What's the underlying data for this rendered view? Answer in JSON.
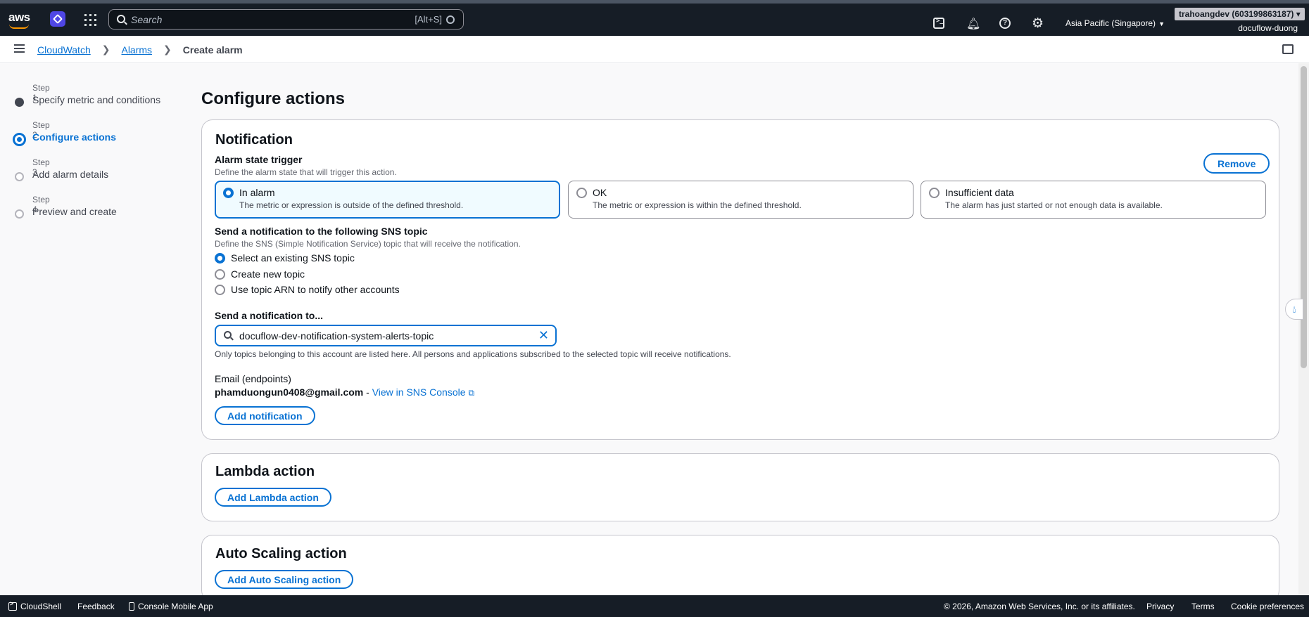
{
  "topnav": {
    "logo_text": "aws",
    "search_placeholder": "Search",
    "search_shortcut": "[Alt+S]",
    "region": "Asia Pacific (Singapore)",
    "account_badge": "trahoangdev (603199863187)",
    "account_name": "docuflow-duong"
  },
  "breadcrumb": {
    "items": [
      "CloudWatch",
      "Alarms"
    ],
    "current": "Create alarm"
  },
  "steps": [
    {
      "num": "Step 1",
      "label": "Specify metric and conditions",
      "state": "done"
    },
    {
      "num": "Step 2",
      "label": "Configure actions",
      "state": "active"
    },
    {
      "num": "Step 3",
      "label": "Add alarm details",
      "state": "pending"
    },
    {
      "num": "Step 4",
      "label": "Preview and create",
      "state": "pending"
    }
  ],
  "page_title": "Configure actions",
  "notification": {
    "heading": "Notification",
    "remove_label": "Remove",
    "trigger_label": "Alarm state trigger",
    "trigger_desc": "Define the alarm state that will trigger this action.",
    "states": [
      {
        "title": "In alarm",
        "desc": "The metric or expression is outside of the defined threshold.",
        "selected": true
      },
      {
        "title": "OK",
        "desc": "The metric or expression is within the defined threshold.",
        "selected": false
      },
      {
        "title": "Insufficient data",
        "desc": "The alarm has just started or not enough data is available.",
        "selected": false
      }
    ],
    "sns_label": "Send a notification to the following SNS topic",
    "sns_desc": "Define the SNS (Simple Notification Service) topic that will receive the notification.",
    "sns_options": [
      "Select an existing SNS topic",
      "Create new topic",
      "Use topic ARN to notify other accounts"
    ],
    "send_to_label": "Send a notification to...",
    "topic_value": "docuflow-dev-notification-system-alerts-topic",
    "topic_hint": "Only topics belonging to this account are listed here. All persons and applications subscribed to the selected topic will receive notifications.",
    "endpoints_label": "Email (endpoints)",
    "email": "phamduongun0408@gmail.com",
    "email_sep": " - ",
    "view_console": "View in SNS Console",
    "add_label": "Add notification"
  },
  "lambda": {
    "heading": "Lambda action",
    "add_label": "Add Lambda action"
  },
  "autoscaling": {
    "heading": "Auto Scaling action",
    "add_label": "Add Auto Scaling action"
  },
  "footer": {
    "cloudshell": "CloudShell",
    "feedback": "Feedback",
    "mobile_app": "Console Mobile App",
    "copyright": "© 2026, Amazon Web Services, Inc. or its affiliates.",
    "privacy": "Privacy",
    "terms": "Terms",
    "cookies": "Cookie preferences"
  },
  "colors": {
    "nav_bg": "#161d26",
    "accent": "#0972d3",
    "border": "#c6c6cd"
  }
}
